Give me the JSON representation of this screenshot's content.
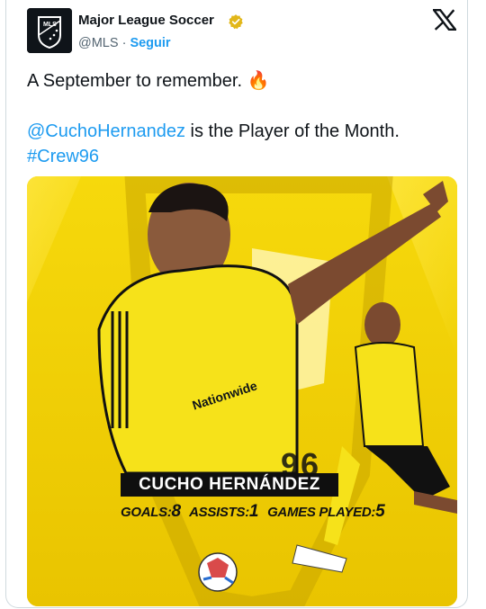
{
  "author": {
    "name": "Major League Soccer",
    "handle": "@MLS",
    "separator": " · ",
    "follow": "Seguir",
    "avatar_text": "MLS"
  },
  "tweet": {
    "line1": "A September to remember. ",
    "line1_emoji": "🔥",
    "mention": "@CuchoHernandez",
    "line2_rest": " is the Player of the Month.",
    "hashtag": "#Crew96"
  },
  "media": {
    "player_name": "CUCHO HERNÁNDEZ",
    "jersey_number": "96",
    "sponsor": "Nationwide",
    "stats": [
      {
        "label": "GOALS:",
        "value": "8"
      },
      {
        "label": "ASSISTS:",
        "value": "1"
      },
      {
        "label": "GAMES PLAYED:",
        "value": "5"
      }
    ]
  },
  "colors": {
    "link": "#1d9bf0",
    "crew_yellow": "#f3d300",
    "text": "#0f1419",
    "muted": "#536471"
  }
}
